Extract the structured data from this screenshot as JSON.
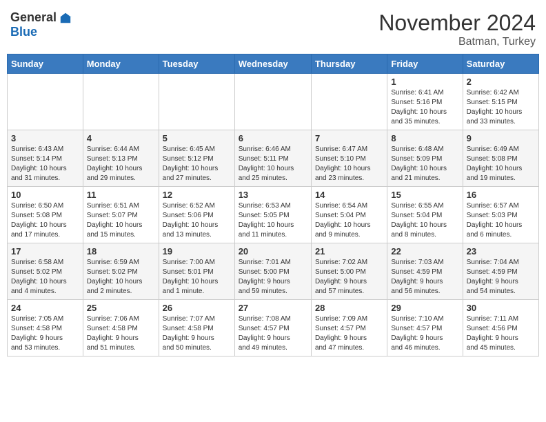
{
  "header": {
    "logo_general": "General",
    "logo_blue": "Blue",
    "month": "November 2024",
    "location": "Batman, Turkey"
  },
  "weekdays": [
    "Sunday",
    "Monday",
    "Tuesday",
    "Wednesday",
    "Thursday",
    "Friday",
    "Saturday"
  ],
  "weeks": [
    [
      {
        "day": "",
        "info": ""
      },
      {
        "day": "",
        "info": ""
      },
      {
        "day": "",
        "info": ""
      },
      {
        "day": "",
        "info": ""
      },
      {
        "day": "",
        "info": ""
      },
      {
        "day": "1",
        "info": "Sunrise: 6:41 AM\nSunset: 5:16 PM\nDaylight: 10 hours\nand 35 minutes."
      },
      {
        "day": "2",
        "info": "Sunrise: 6:42 AM\nSunset: 5:15 PM\nDaylight: 10 hours\nand 33 minutes."
      }
    ],
    [
      {
        "day": "3",
        "info": "Sunrise: 6:43 AM\nSunset: 5:14 PM\nDaylight: 10 hours\nand 31 minutes."
      },
      {
        "day": "4",
        "info": "Sunrise: 6:44 AM\nSunset: 5:13 PM\nDaylight: 10 hours\nand 29 minutes."
      },
      {
        "day": "5",
        "info": "Sunrise: 6:45 AM\nSunset: 5:12 PM\nDaylight: 10 hours\nand 27 minutes."
      },
      {
        "day": "6",
        "info": "Sunrise: 6:46 AM\nSunset: 5:11 PM\nDaylight: 10 hours\nand 25 minutes."
      },
      {
        "day": "7",
        "info": "Sunrise: 6:47 AM\nSunset: 5:10 PM\nDaylight: 10 hours\nand 23 minutes."
      },
      {
        "day": "8",
        "info": "Sunrise: 6:48 AM\nSunset: 5:09 PM\nDaylight: 10 hours\nand 21 minutes."
      },
      {
        "day": "9",
        "info": "Sunrise: 6:49 AM\nSunset: 5:08 PM\nDaylight: 10 hours\nand 19 minutes."
      }
    ],
    [
      {
        "day": "10",
        "info": "Sunrise: 6:50 AM\nSunset: 5:08 PM\nDaylight: 10 hours\nand 17 minutes."
      },
      {
        "day": "11",
        "info": "Sunrise: 6:51 AM\nSunset: 5:07 PM\nDaylight: 10 hours\nand 15 minutes."
      },
      {
        "day": "12",
        "info": "Sunrise: 6:52 AM\nSunset: 5:06 PM\nDaylight: 10 hours\nand 13 minutes."
      },
      {
        "day": "13",
        "info": "Sunrise: 6:53 AM\nSunset: 5:05 PM\nDaylight: 10 hours\nand 11 minutes."
      },
      {
        "day": "14",
        "info": "Sunrise: 6:54 AM\nSunset: 5:04 PM\nDaylight: 10 hours\nand 9 minutes."
      },
      {
        "day": "15",
        "info": "Sunrise: 6:55 AM\nSunset: 5:04 PM\nDaylight: 10 hours\nand 8 minutes."
      },
      {
        "day": "16",
        "info": "Sunrise: 6:57 AM\nSunset: 5:03 PM\nDaylight: 10 hours\nand 6 minutes."
      }
    ],
    [
      {
        "day": "17",
        "info": "Sunrise: 6:58 AM\nSunset: 5:02 PM\nDaylight: 10 hours\nand 4 minutes."
      },
      {
        "day": "18",
        "info": "Sunrise: 6:59 AM\nSunset: 5:02 PM\nDaylight: 10 hours\nand 2 minutes."
      },
      {
        "day": "19",
        "info": "Sunrise: 7:00 AM\nSunset: 5:01 PM\nDaylight: 10 hours\nand 1 minute."
      },
      {
        "day": "20",
        "info": "Sunrise: 7:01 AM\nSunset: 5:00 PM\nDaylight: 9 hours\nand 59 minutes."
      },
      {
        "day": "21",
        "info": "Sunrise: 7:02 AM\nSunset: 5:00 PM\nDaylight: 9 hours\nand 57 minutes."
      },
      {
        "day": "22",
        "info": "Sunrise: 7:03 AM\nSunset: 4:59 PM\nDaylight: 9 hours\nand 56 minutes."
      },
      {
        "day": "23",
        "info": "Sunrise: 7:04 AM\nSunset: 4:59 PM\nDaylight: 9 hours\nand 54 minutes."
      }
    ],
    [
      {
        "day": "24",
        "info": "Sunrise: 7:05 AM\nSunset: 4:58 PM\nDaylight: 9 hours\nand 53 minutes."
      },
      {
        "day": "25",
        "info": "Sunrise: 7:06 AM\nSunset: 4:58 PM\nDaylight: 9 hours\nand 51 minutes."
      },
      {
        "day": "26",
        "info": "Sunrise: 7:07 AM\nSunset: 4:58 PM\nDaylight: 9 hours\nand 50 minutes."
      },
      {
        "day": "27",
        "info": "Sunrise: 7:08 AM\nSunset: 4:57 PM\nDaylight: 9 hours\nand 49 minutes."
      },
      {
        "day": "28",
        "info": "Sunrise: 7:09 AM\nSunset: 4:57 PM\nDaylight: 9 hours\nand 47 minutes."
      },
      {
        "day": "29",
        "info": "Sunrise: 7:10 AM\nSunset: 4:57 PM\nDaylight: 9 hours\nand 46 minutes."
      },
      {
        "day": "30",
        "info": "Sunrise: 7:11 AM\nSunset: 4:56 PM\nDaylight: 9 hours\nand 45 minutes."
      }
    ]
  ]
}
